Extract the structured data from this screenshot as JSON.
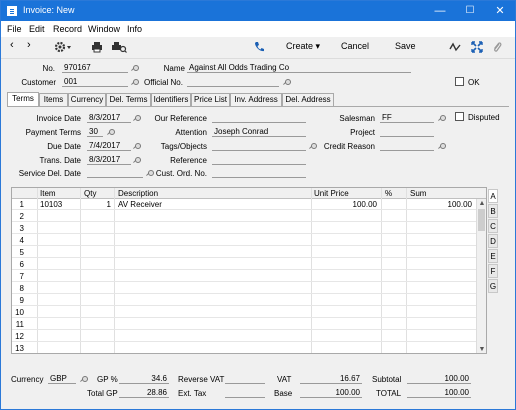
{
  "window": {
    "title": "Invoice: New",
    "minimize": "—",
    "maximize": "☐",
    "close": "✕"
  },
  "menu": [
    "File",
    "Edit",
    "Record",
    "Window",
    "Info"
  ],
  "toolbar": {
    "back": "‹",
    "forward": "›",
    "create_label": "Create",
    "cancel_label": "Cancel",
    "save_label": "Save"
  },
  "header": {
    "no_label": "No.",
    "no_value": "970167",
    "name_label": "Name",
    "name_value": "Against All Odds Trading Co",
    "customer_label": "Customer",
    "customer_value": "001",
    "official_no_label": "Official No.",
    "official_no_value": "",
    "ok_label": "OK",
    "ok_checked": false
  },
  "tabs": [
    "Terms",
    "Items",
    "Currency",
    "Del. Terms",
    "Identifiers",
    "Price List",
    "Inv. Address",
    "Del. Address"
  ],
  "active_tab": "Terms",
  "terms": {
    "invoice_date_label": "Invoice Date",
    "invoice_date": "8/3/2017",
    "payment_terms_label": "Payment Terms",
    "payment_terms": "30",
    "due_date_label": "Due Date",
    "due_date": "7/4/2017",
    "trans_date_label": "Trans. Date",
    "trans_date": "8/3/2017",
    "service_del_date_label": "Service Del. Date",
    "service_del_date": "",
    "our_reference_label": "Our Reference",
    "our_reference": "",
    "attention_label": "Attention",
    "attention": "Joseph Conrad",
    "tags_label": "Tags/Objects",
    "tags": "",
    "reference_label": "Reference",
    "reference": "",
    "cust_ord_no_label": "Cust. Ord. No.",
    "cust_ord_no": "",
    "salesman_label": "Salesman",
    "salesman": "FF",
    "project_label": "Project",
    "project": "",
    "credit_reason_label": "Credit Reason",
    "credit_reason": "",
    "disputed_label": "Disputed",
    "disputed_checked": false
  },
  "grid": {
    "columns": [
      "Item",
      "Qty",
      "Description",
      "Unit Price",
      "%",
      "Sum"
    ],
    "row_numbers": [
      "1",
      "2",
      "3",
      "4",
      "5",
      "6",
      "7",
      "8",
      "9",
      "10",
      "11",
      "12",
      "13"
    ],
    "rows": [
      {
        "item": "10103",
        "qty": "1",
        "description": "AV Receiver",
        "unit_price": "100.00",
        "pct": "",
        "sum": "100.00"
      }
    ]
  },
  "side_letters": [
    "A",
    "B",
    "C",
    "D",
    "E",
    "F",
    "G"
  ],
  "footer": {
    "currency_label": "Currency",
    "currency": "GBP",
    "gp_pct_label": "GP %",
    "gp_pct": "34.6",
    "total_gp_label": "Total GP",
    "total_gp": "28.86",
    "reverse_vat_label": "Reverse VAT",
    "reverse_vat": "",
    "ext_tax_label": "Ext. Tax",
    "ext_tax": "",
    "vat_label": "VAT",
    "vat": "16.67",
    "base_label": "Base",
    "base": "100.00",
    "subtotal_label": "Subtotal",
    "subtotal": "100.00",
    "total_label": "TOTAL",
    "total": "100.00"
  }
}
